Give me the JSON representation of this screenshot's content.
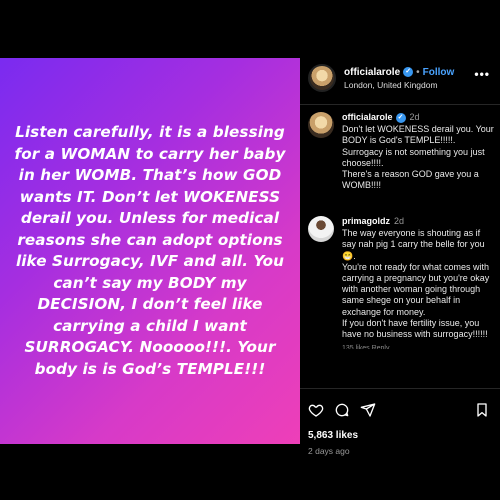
{
  "post_image": {
    "text": "Listen carefully, it is a blessing for a WOMAN to carry her baby in her WOMB. That’s how GOD wants IT. Don’t let WOKENESS derail you. Unless for medical reasons she can adopt options like Surrogacy, IVF and all. You can’t say my BODY my DECISION, I don’t feel like carrying a child I want SURROGACY. Nooooo!!!. Your body is is God’s TEMPLE!!!"
  },
  "header": {
    "username": "officialarole",
    "verified_mark": "✓",
    "separator": "•",
    "follow_label": "Follow",
    "location": "London, United Kingdom",
    "more": "•••"
  },
  "comments": [
    {
      "username": "officialarole",
      "verified_mark": "✓",
      "time": "2d",
      "text": "Don't let WOKENESS derail you. Your BODY is God's TEMPLE!!!!!.\nSurrogacy is not something you just choose!!!!.\nThere's a reason GOD gave you a WOMB!!!!"
    },
    {
      "username": "primagoldz",
      "time": "2d",
      "text": "The way everyone is shouting as if say nah pig 1 carry the belle for you 😁.\nYou're not ready for what comes with carrying a pregnancy but you're okay with another woman going through same shege on your behalf in exchange for money.\nIf you don't have fertility issue, you have no business with surrogacy!!!!!!",
      "meta": "135 likes   Reply"
    }
  ],
  "actions": {
    "like_icon": "heart-outline",
    "comment_icon": "speech-bubble",
    "share_icon": "paper-plane",
    "bookmark_icon": "bookmark"
  },
  "likes": "5,863 likes",
  "posted_ago": "2 days ago"
}
